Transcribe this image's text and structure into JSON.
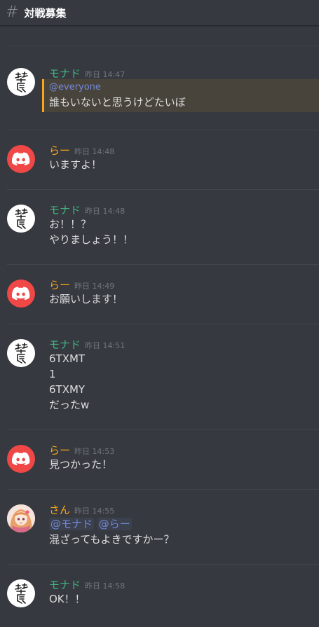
{
  "header": {
    "hash": "#",
    "channel_name": "対戦募集"
  },
  "colors": {
    "background": "#36393f",
    "monado_name": "#43b581",
    "ra_name": "#faa61a",
    "san_name": "#faa61a",
    "mention": "#7289da",
    "discord_avatar": "#f04747"
  },
  "messages": [
    {
      "author": "モナド",
      "time": "昨日 14:47",
      "avatar": "kanji-avatar",
      "mention": "@everyone",
      "lines": [
        "誰もいないと思うけどたいぼ"
      ]
    },
    {
      "author": "らー",
      "time": "昨日 14:48",
      "avatar": "discord-avatar",
      "lines": [
        "いますよ！"
      ]
    },
    {
      "author": "モナド",
      "time": "昨日 14:48",
      "avatar": "kanji-avatar",
      "lines": [
        "お！！？",
        "やりましょう！！"
      ]
    },
    {
      "author": "らー",
      "time": "昨日 14:49",
      "avatar": "discord-avatar",
      "lines": [
        "お願いします！"
      ]
    },
    {
      "author": "モナド",
      "time": "昨日 14:51",
      "avatar": "kanji-avatar",
      "lines": [
        "6TXMT",
        "1",
        "6TXMY",
        "だったw"
      ]
    },
    {
      "author": "らー",
      "time": "昨日 14:53",
      "avatar": "discord-avatar",
      "lines": [
        "見つかった！"
      ]
    },
    {
      "author": "さん",
      "time": "昨日 14:55",
      "avatar": "anime-avatar",
      "mentions": [
        "@モナド",
        "@らー"
      ],
      "lines": [
        "混ざってもよきですかー？"
      ]
    },
    {
      "author": "モナド",
      "time": "昨日 14:58",
      "avatar": "kanji-avatar",
      "lines": [
        "OK！！"
      ]
    }
  ]
}
